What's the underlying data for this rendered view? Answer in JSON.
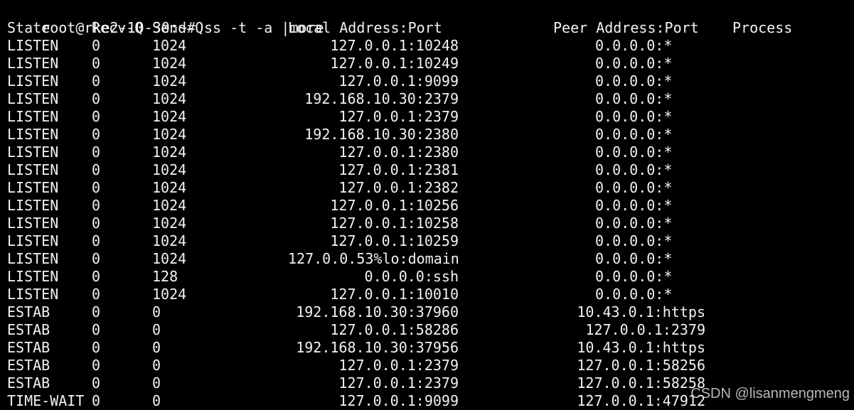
{
  "terminal": {
    "background": "#000000",
    "foreground": "#f2f2f2",
    "prompt": "root@rke2-10-30:~#",
    "command": "ss -t -a |more",
    "headers": {
      "state": "State",
      "recv_q": "Recv-Q",
      "send_q": "Send-Q",
      "local": "Local Address:Port",
      "peer": "Peer Address:Port",
      "process": "Process"
    },
    "rows": [
      {
        "state": "LISTEN",
        "recv_q": "0",
        "send_q": "1024",
        "local": "127.0.0.1:10248",
        "peer": "0.0.0.0:*"
      },
      {
        "state": "LISTEN",
        "recv_q": "0",
        "send_q": "1024",
        "local": "127.0.0.1:10249",
        "peer": "0.0.0.0:*"
      },
      {
        "state": "LISTEN",
        "recv_q": "0",
        "send_q": "1024",
        "local": "127.0.0.1:9099",
        "peer": "0.0.0.0:*"
      },
      {
        "state": "LISTEN",
        "recv_q": "0",
        "send_q": "1024",
        "local": "192.168.10.30:2379",
        "peer": "0.0.0.0:*"
      },
      {
        "state": "LISTEN",
        "recv_q": "0",
        "send_q": "1024",
        "local": "127.0.0.1:2379",
        "peer": "0.0.0.0:*"
      },
      {
        "state": "LISTEN",
        "recv_q": "0",
        "send_q": "1024",
        "local": "192.168.10.30:2380",
        "peer": "0.0.0.0:*"
      },
      {
        "state": "LISTEN",
        "recv_q": "0",
        "send_q": "1024",
        "local": "127.0.0.1:2380",
        "peer": "0.0.0.0:*"
      },
      {
        "state": "LISTEN",
        "recv_q": "0",
        "send_q": "1024",
        "local": "127.0.0.1:2381",
        "peer": "0.0.0.0:*"
      },
      {
        "state": "LISTEN",
        "recv_q": "0",
        "send_q": "1024",
        "local": "127.0.0.1:2382",
        "peer": "0.0.0.0:*"
      },
      {
        "state": "LISTEN",
        "recv_q": "0",
        "send_q": "1024",
        "local": "127.0.0.1:10256",
        "peer": "0.0.0.0:*"
      },
      {
        "state": "LISTEN",
        "recv_q": "0",
        "send_q": "1024",
        "local": "127.0.0.1:10258",
        "peer": "0.0.0.0:*"
      },
      {
        "state": "LISTEN",
        "recv_q": "0",
        "send_q": "1024",
        "local": "127.0.0.1:10259",
        "peer": "0.0.0.0:*"
      },
      {
        "state": "LISTEN",
        "recv_q": "0",
        "send_q": "1024",
        "local": "127.0.0.53%lo:domain",
        "peer": "0.0.0.0:*"
      },
      {
        "state": "LISTEN",
        "recv_q": "0",
        "send_q": "128",
        "local": "0.0.0.0:ssh",
        "peer": "0.0.0.0:*"
      },
      {
        "state": "LISTEN",
        "recv_q": "0",
        "send_q": "1024",
        "local": "127.0.0.1:10010",
        "peer": "0.0.0.0:*"
      },
      {
        "state": "ESTAB",
        "recv_q": "0",
        "send_q": "0",
        "local": "192.168.10.30:37960",
        "peer": "10.43.0.1:https"
      },
      {
        "state": "ESTAB",
        "recv_q": "0",
        "send_q": "0",
        "local": "127.0.0.1:58286",
        "peer": "127.0.0.1:2379"
      },
      {
        "state": "ESTAB",
        "recv_q": "0",
        "send_q": "0",
        "local": "192.168.10.30:37956",
        "peer": "10.43.0.1:https"
      },
      {
        "state": "ESTAB",
        "recv_q": "0",
        "send_q": "0",
        "local": "127.0.0.1:2379",
        "peer": "127.0.0.1:58256"
      },
      {
        "state": "ESTAB",
        "recv_q": "0",
        "send_q": "0",
        "local": "127.0.0.1:2379",
        "peer": "127.0.0.1:58258"
      },
      {
        "state": "TIME-WAIT",
        "recv_q": "0",
        "send_q": "0",
        "local": "127.0.0.1:9099",
        "peer": "127.0.0.1:47912"
      }
    ]
  },
  "watermark": "CSDN @lisanmengmeng"
}
